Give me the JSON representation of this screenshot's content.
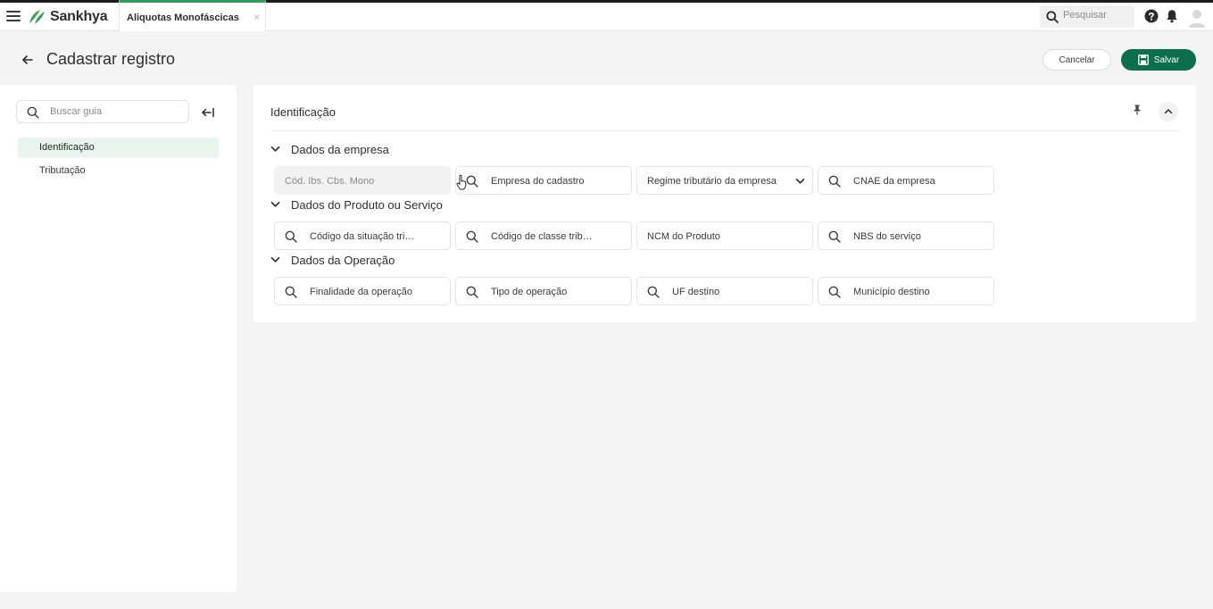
{
  "topbar": {
    "brand": "Sankhya",
    "tab_label": "Aliquotas Monofáscicas",
    "tab_close": "×",
    "search_placeholder": "Pesquisar"
  },
  "header": {
    "title": "Cadastrar registro",
    "cancel_label": "Cancelar",
    "save_label": "Salvar"
  },
  "sidebar": {
    "search_placeholder": "Buscar guia",
    "items": [
      {
        "label": "Identificação",
        "active": true
      },
      {
        "label": "Tributação",
        "active": false
      }
    ]
  },
  "main": {
    "card_title": "Identificação",
    "sections": [
      {
        "title": "Dados da empresa",
        "fields": [
          {
            "label": "Cód. Ibs. Cbs. Mono",
            "type": "disabled"
          },
          {
            "label": "Empresa do cadastro",
            "type": "lookup"
          },
          {
            "label": "Regime tributário da empresa",
            "type": "select"
          },
          {
            "label": "CNAE da empresa",
            "type": "lookup"
          }
        ]
      },
      {
        "title": "Dados do Produto ou Serviço",
        "fields": [
          {
            "label": "Código da situação tributária",
            "type": "lookup"
          },
          {
            "label": "Código de classe tributária",
            "type": "lookup"
          },
          {
            "label": "NCM do Produto",
            "type": "text"
          },
          {
            "label": "NBS do serviço",
            "type": "lookup"
          }
        ]
      },
      {
        "title": "Dados da Operação",
        "fields": [
          {
            "label": "Finalidade da operação",
            "type": "lookup"
          },
          {
            "label": "Tipo de operação",
            "type": "lookup"
          },
          {
            "label": "UF destino",
            "type": "lookup"
          },
          {
            "label": "Município destino",
            "type": "lookup"
          }
        ]
      }
    ]
  },
  "colors": {
    "accent": "#0b6e4c",
    "brand_green": "#2e9e5a",
    "active_nav_bg": "#e9f4ee"
  },
  "icons": [
    "menu-icon",
    "sankhya-logo-icon",
    "search-icon",
    "help-icon",
    "bell-icon",
    "avatar-icon",
    "back-arrow-icon",
    "save-icon",
    "collapse-left-icon",
    "pin-icon",
    "chevron-up-icon",
    "chevron-down-icon"
  ]
}
